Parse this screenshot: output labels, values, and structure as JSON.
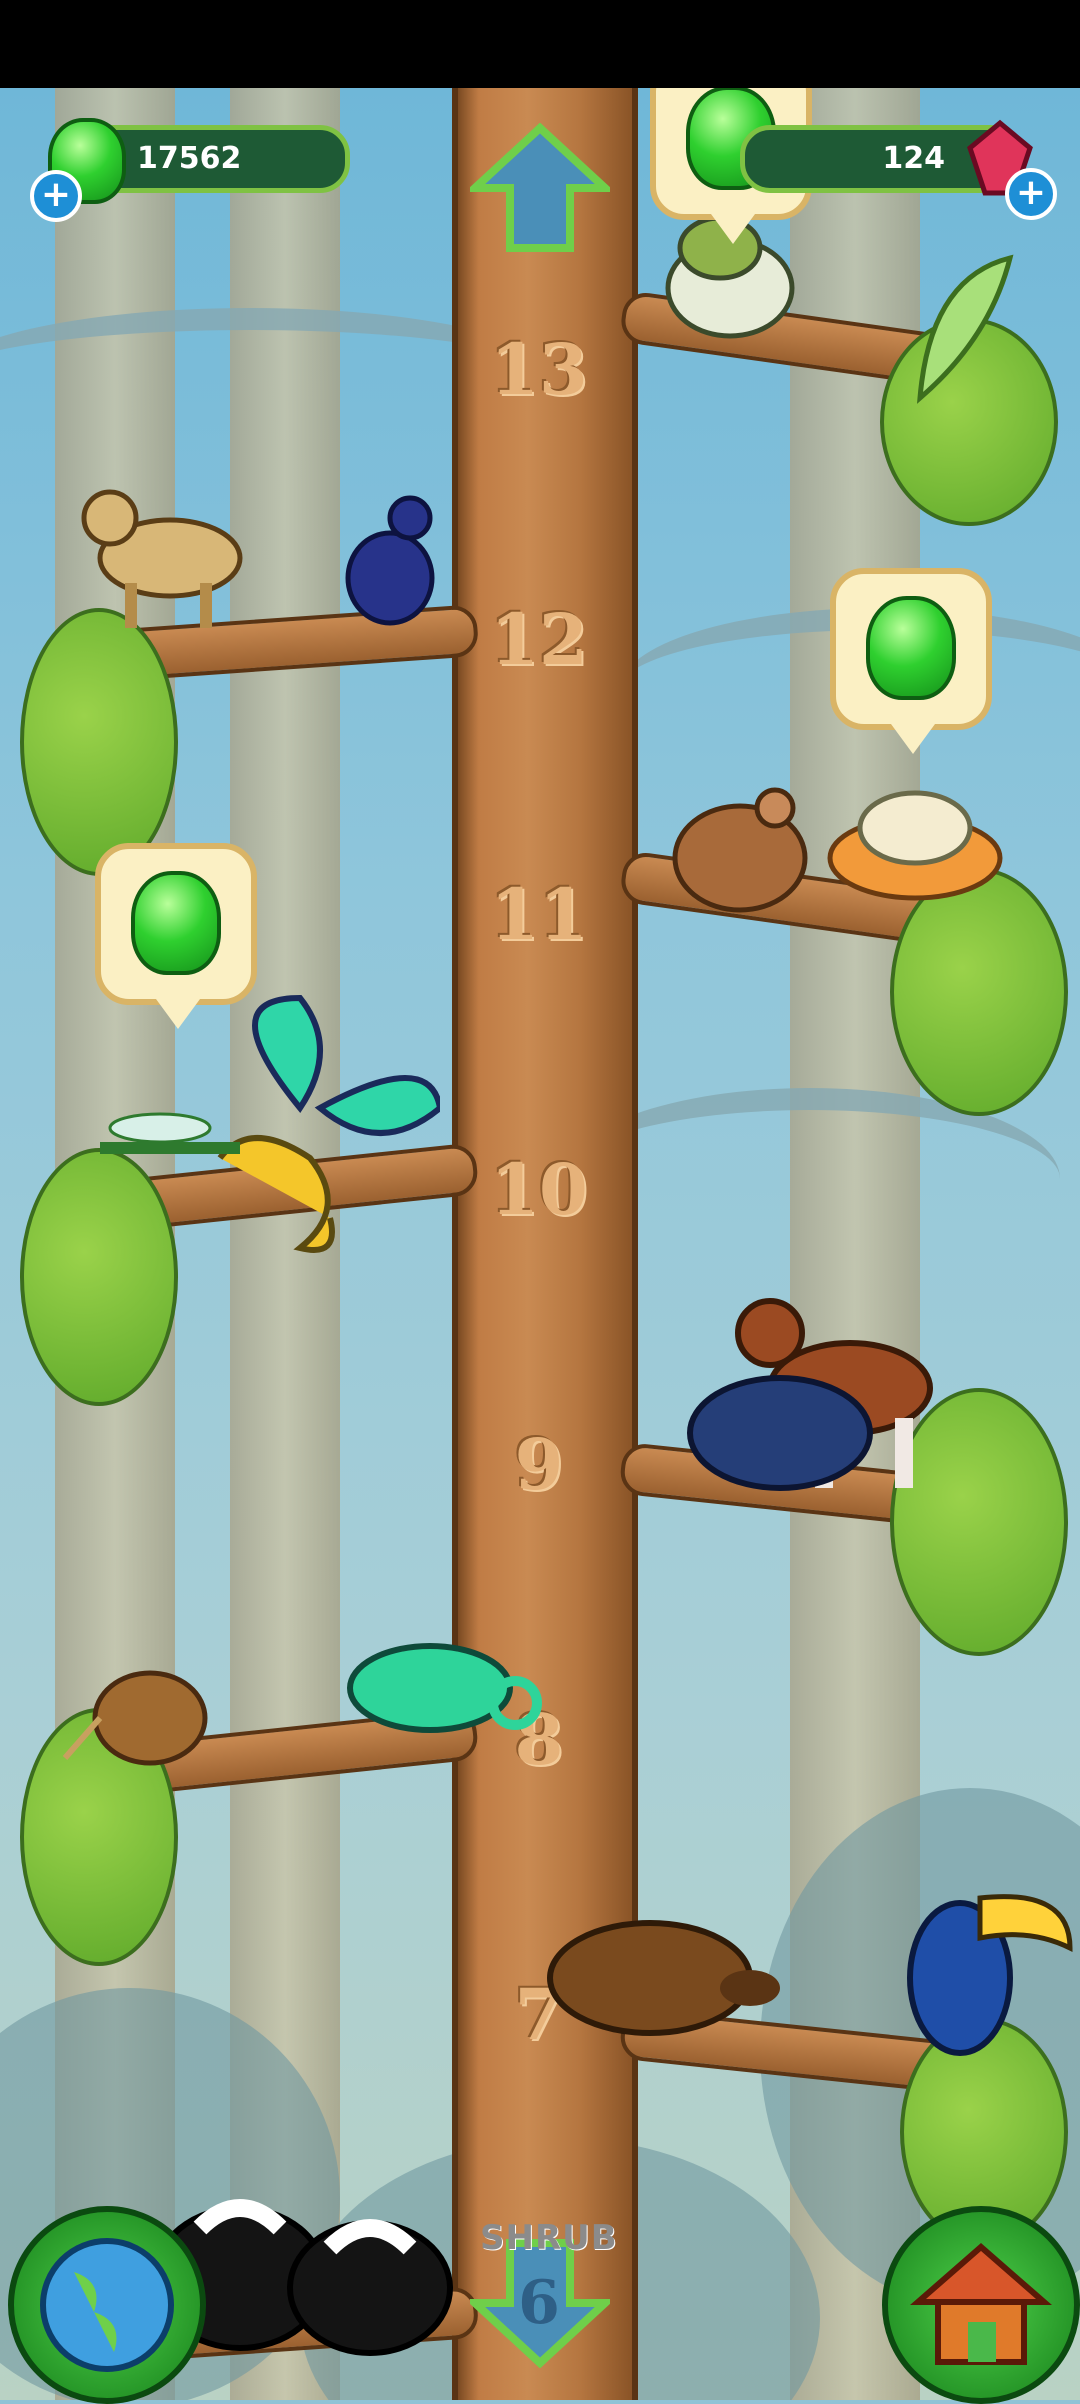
{
  "hud": {
    "gems": "17562",
    "crystals": "124",
    "gems_plus": "+",
    "crystals_plus": "+"
  },
  "tree": {
    "levels": [
      "13",
      "12",
      "11",
      "10",
      "9",
      "8",
      "7"
    ],
    "area_label": "SHRUB",
    "nav_up": "up-arrow",
    "nav_down": "down-arrow",
    "lower_level": "6"
  },
  "icons": {
    "map": "globe-icon",
    "home": "house-icon",
    "gem": "green-gem-icon",
    "crystal": "red-crystal-icon"
  },
  "colors": {
    "hud_bg": "#1e5a35",
    "hud_border": "#7fc243",
    "gem": "#2fd02f",
    "plus": "#1e8fd6"
  }
}
